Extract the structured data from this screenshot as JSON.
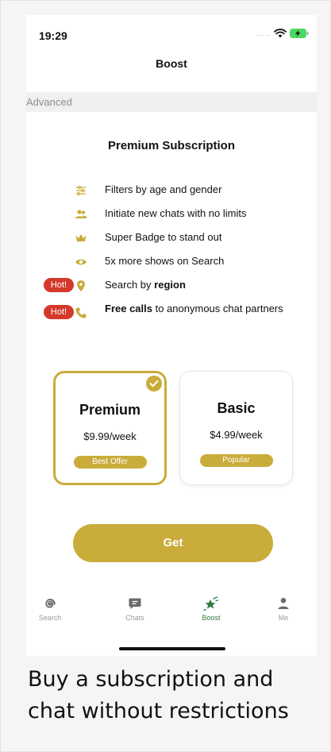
{
  "status_bar": {
    "time": "19:29"
  },
  "nav": {
    "title": "Boost"
  },
  "section": {
    "label": "Advanced"
  },
  "premium": {
    "title": "Premium Subscription",
    "features": [
      {
        "icon": "filters-icon",
        "text": "Filters by age and gender",
        "hot": ""
      },
      {
        "icon": "people-icon",
        "text": "Initiate new chats with no limits",
        "hot": ""
      },
      {
        "icon": "crown-icon",
        "text": "Super Badge to stand out",
        "hot": ""
      },
      {
        "icon": "eye-icon",
        "text": "5x more shows on Search",
        "hot": ""
      },
      {
        "icon": "location-pin-icon",
        "text_prefix": "Search by ",
        "text_bold": "region",
        "text_suffix": "",
        "hot": "Hot!"
      },
      {
        "icon": "phone-icon",
        "text_prefix": "",
        "text_bold": "Free calls",
        "text_suffix": " to anonymous chat partners",
        "hot": "Hot!"
      }
    ]
  },
  "plans": [
    {
      "name": "Premium",
      "price": "$9.99/week",
      "badge": "Best Offer",
      "selected": true
    },
    {
      "name": "Basic",
      "price": "$4.99/week",
      "badge": "Popular",
      "selected": false
    }
  ],
  "get_button": {
    "label": "Get"
  },
  "tabbar": {
    "tabs": [
      {
        "label": "Search",
        "icon": "spiral-icon",
        "active": false
      },
      {
        "label": "Chats",
        "icon": "chat-bubble-icon",
        "active": false
      },
      {
        "label": "Boost",
        "icon": "rocket-icon",
        "active": true
      },
      {
        "label": "Me",
        "icon": "person-icon",
        "active": false
      }
    ]
  },
  "caption": "Buy a subscription and chat without restrictions",
  "colors": {
    "gold": "#c9ac3a",
    "hot": "#d33a2c",
    "active_tab": "#2f7d3c"
  }
}
